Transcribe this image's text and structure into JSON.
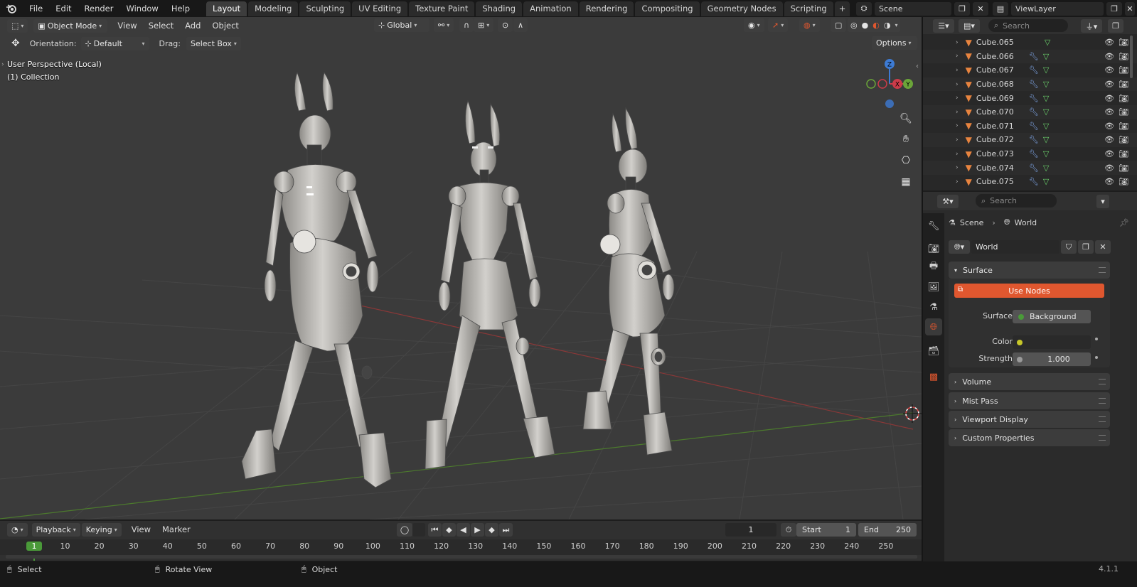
{
  "topbar": {
    "menus": [
      "File",
      "Edit",
      "Render",
      "Window",
      "Help"
    ],
    "workspaces": [
      "Layout",
      "Modeling",
      "Sculpting",
      "UV Editing",
      "Texture Paint",
      "Shading",
      "Animation",
      "Rendering",
      "Compositing",
      "Geometry Nodes",
      "Scripting"
    ],
    "active_workspace": "Layout",
    "add_tab": "+",
    "scene": "Scene",
    "view_layer": "ViewLayer"
  },
  "viewport": {
    "mode": "Object Mode",
    "menus": [
      "View",
      "Select",
      "Add",
      "Object"
    ],
    "transform_orientation": "Global",
    "orientation_label": "Orientation:",
    "orientation_value": "Default",
    "drag_label": "Drag:",
    "drag_value": "Select Box",
    "options_label": "Options",
    "perspective_text": "User Perspective (Local)",
    "collection_text": "(1) Collection",
    "gizmo_axes": {
      "z": "Z",
      "x": "X",
      "y": "Y"
    }
  },
  "outliner": {
    "search_placeholder": "Search",
    "rows": [
      "Cube.065",
      "Cube.066",
      "Cube.067",
      "Cube.068",
      "Cube.069",
      "Cube.070",
      "Cube.071",
      "Cube.072",
      "Cube.073",
      "Cube.074",
      "Cube.075"
    ]
  },
  "properties": {
    "search_placeholder": "Search",
    "breadcrumb": [
      "Scene",
      "World"
    ],
    "world_name": "World",
    "surface_panel": "Surface",
    "use_nodes": "Use Nodes",
    "surface_label": "Surface",
    "surface_value": "Background",
    "color_label": "Color",
    "strength_label": "Strength",
    "strength_value": "1.000",
    "collapsed_panels": [
      "Volume",
      "Mist Pass",
      "Viewport Display",
      "Custom Properties"
    ]
  },
  "timeline": {
    "menus": [
      "Playback",
      "Keying",
      "View",
      "Marker"
    ],
    "current_frame": "1",
    "start_label": "Start",
    "start_value": "1",
    "end_label": "End",
    "end_value": "250",
    "ruler": [
      "1",
      "10",
      "20",
      "30",
      "40",
      "50",
      "60",
      "70",
      "80",
      "90",
      "100",
      "110",
      "120",
      "130",
      "140",
      "150",
      "160",
      "170",
      "180",
      "190",
      "200",
      "210",
      "220",
      "230",
      "240",
      "250"
    ]
  },
  "statusbar": {
    "select": "Select",
    "rotate": "Rotate View",
    "object": "Object",
    "version": "4.1.1"
  },
  "colors": {
    "accent_red": "#e0572f",
    "active_tab": "#3d3d3d",
    "frame_green": "#4a9a39",
    "x_axis": "#cc3b49",
    "y_axis": "#6ba539",
    "z_axis": "#3d7bd4"
  }
}
